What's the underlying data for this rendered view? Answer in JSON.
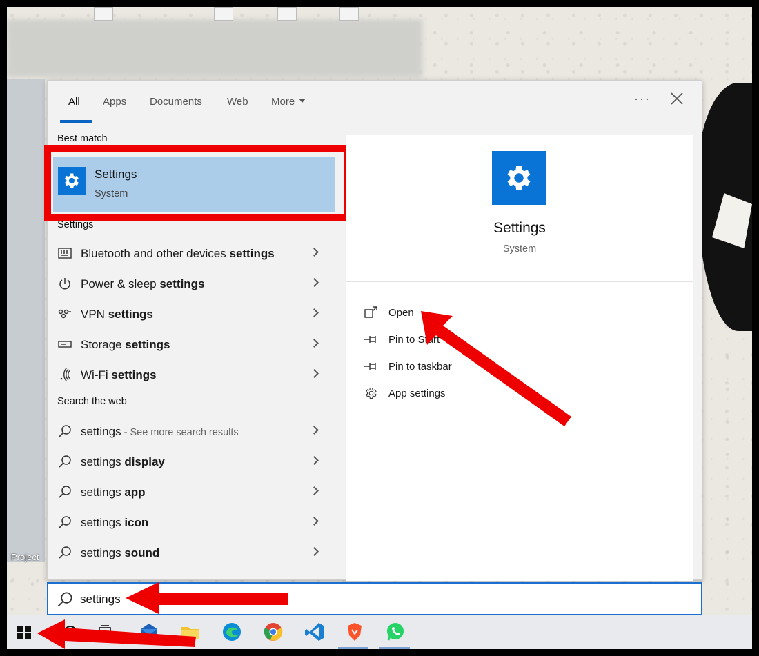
{
  "tabs": {
    "all": "All",
    "apps": "Apps",
    "documents": "Documents",
    "web": "Web",
    "more": "More",
    "ellipsis": "···"
  },
  "best_match": {
    "section": "Best match",
    "title": "Settings",
    "subtitle": "System"
  },
  "settings_section": {
    "label": "Settings",
    "items": [
      {
        "plain": "Bluetooth and other devices ",
        "bold": "settings",
        "icon": "keyboard-icon"
      },
      {
        "plain": "Power & sleep ",
        "bold": "settings",
        "icon": "power-icon"
      },
      {
        "plain": "VPN ",
        "bold": "settings",
        "icon": "vpn-icon"
      },
      {
        "plain": "Storage ",
        "bold": "settings",
        "icon": "storage-icon"
      },
      {
        "plain": "Wi-Fi ",
        "bold": "settings",
        "icon": "wifi-icon"
      }
    ]
  },
  "web_section": {
    "label": "Search the web",
    "items": [
      {
        "plain": "settings",
        "bold": "",
        "hint": " - See more search results"
      },
      {
        "plain": "settings ",
        "bold": "display",
        "hint": ""
      },
      {
        "plain": "settings ",
        "bold": "app",
        "hint": ""
      },
      {
        "plain": "settings ",
        "bold": "icon",
        "hint": ""
      },
      {
        "plain": "settings ",
        "bold": "sound",
        "hint": ""
      }
    ]
  },
  "preview": {
    "title": "Settings",
    "subtitle": "System",
    "actions": [
      "Open",
      "Pin to Start",
      "Pin to taskbar",
      "App settings"
    ]
  },
  "search_box": {
    "value": "settings"
  },
  "desktop": {
    "project_label": "Project"
  },
  "colors": {
    "accent": "#0a74d6",
    "selection": "#abcde9",
    "annotation_red": "#ee0000"
  }
}
